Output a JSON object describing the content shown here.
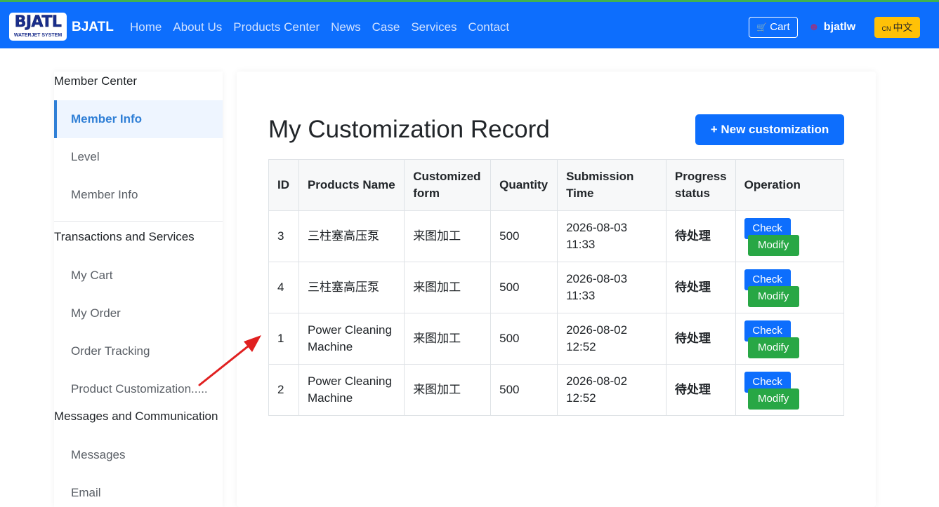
{
  "header": {
    "logo_text": "BJATL",
    "logo_subtext": "WATERJET SYSTEM",
    "brand": "BJATL",
    "nav": [
      "Home",
      "About Us",
      "Products Center",
      "News",
      "Case",
      "Services",
      "Contact"
    ],
    "cart_label": "Cart",
    "username": "bjatlw",
    "lang_flag": "CN",
    "lang_label": "中文"
  },
  "sidebar": {
    "section_member": "Member Center",
    "member_items": [
      "Member Info",
      "Level",
      "Member Info"
    ],
    "section_transactions": "Transactions and Services",
    "transaction_items": [
      "My Cart",
      "My Order",
      "Order Tracking",
      "Product Customization....."
    ],
    "section_messages": "Messages and Communication",
    "message_items": [
      "Messages",
      "Email"
    ]
  },
  "main": {
    "title": "My Customization Record",
    "new_button": "+ New customization",
    "columns": [
      "ID",
      "Products Name",
      "Customized form",
      "Quantity",
      "Submission Time",
      "Progress status",
      "Operation"
    ],
    "rows": [
      {
        "id": "3",
        "product": "三柱塞高压泵",
        "form": "来图加工",
        "quantity": "500",
        "time": "2026-08-03 11:33",
        "status": "待处理"
      },
      {
        "id": "4",
        "product": "三柱塞高压泵",
        "form": "来图加工",
        "quantity": "500",
        "time": "2026-08-03 11:33",
        "status": "待处理"
      },
      {
        "id": "1",
        "product": "Power Cleaning Machine",
        "form": "来图加工",
        "quantity": "500",
        "time": "2026-08-02 12:52",
        "status": "待处理"
      },
      {
        "id": "2",
        "product": "Power Cleaning Machine",
        "form": "来图加工",
        "quantity": "500",
        "time": "2026-08-02 12:52",
        "status": "待处理"
      }
    ],
    "check_label": "Check",
    "modify_label": "Modify"
  },
  "colors": {
    "navbar": "#0d6efd",
    "accent": "#2f7fd6",
    "status": "#f5b800",
    "modify": "#28a745",
    "lang": "#ffc107",
    "annotation_arrow": "#e02020"
  }
}
